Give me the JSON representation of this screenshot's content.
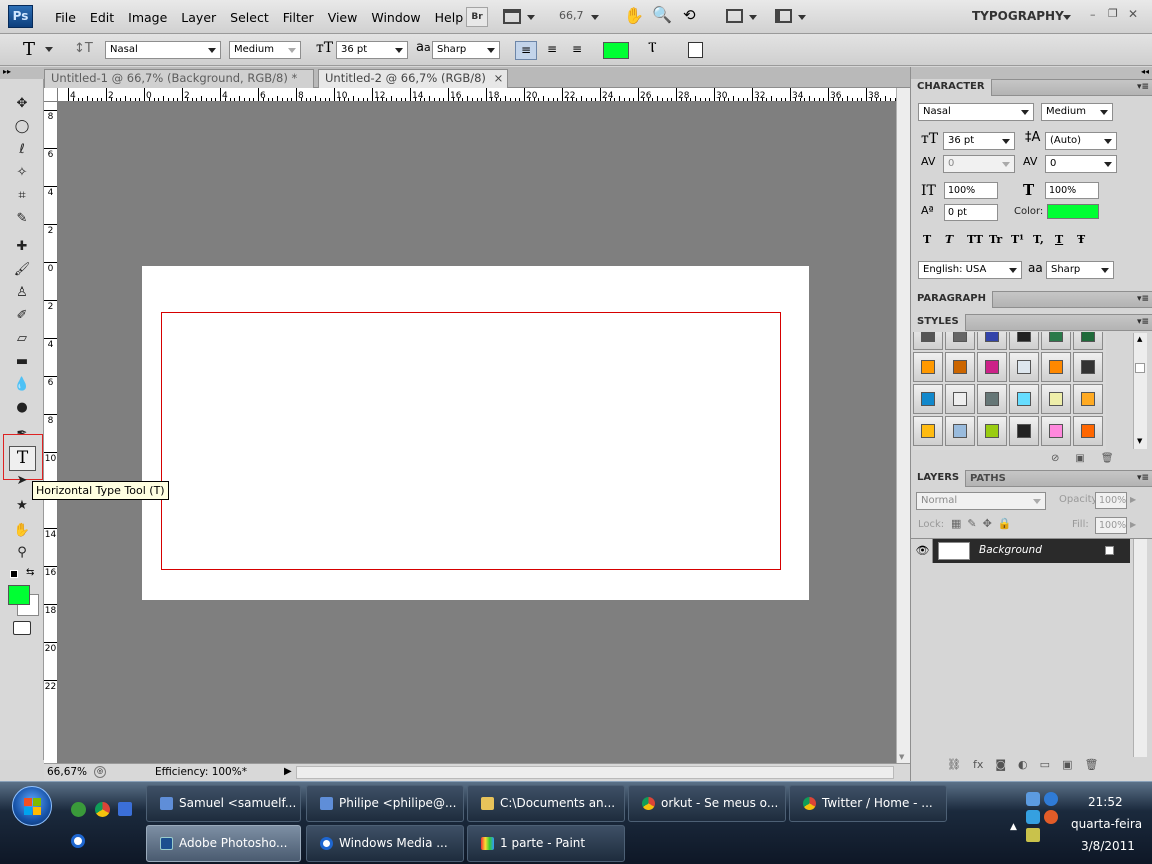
{
  "app": {
    "logo": "Ps",
    "workspace": "TYPOGRAPHY",
    "zoom_display": "66,7"
  },
  "menu": [
    "File",
    "Edit",
    "Image",
    "Layer",
    "Select",
    "Filter",
    "View",
    "Window",
    "Help"
  ],
  "toolbar_buttons": {
    "bridge": "Br"
  },
  "options": {
    "tool_glyph": "T",
    "font_family": "Nasal",
    "font_style": "Medium",
    "font_size": "36 pt",
    "aa_label": "a",
    "aa_method": "Sharp",
    "text_color": "#00ff33"
  },
  "tabs": [
    {
      "label": "Untitled-1 @ 66,7% (Background, RGB/8) *",
      "close": "×"
    },
    {
      "label": "Untitled-2 @ 66,7% (RGB/8)",
      "close": "×"
    }
  ],
  "ruler": {
    "h_ticks": [
      "4",
      "2",
      "0",
      "2",
      "4",
      "6",
      "8",
      "10",
      "12",
      "14",
      "16",
      "18",
      "20",
      "22",
      "24",
      "26",
      "28",
      "30",
      "32",
      "34",
      "36",
      "38"
    ],
    "v_ticks": [
      "8",
      "6",
      "4",
      "2",
      "0",
      "2",
      "4",
      "6",
      "8",
      "10",
      "12",
      "14",
      "16",
      "18",
      "20",
      "22"
    ]
  },
  "tooltip": "Horizontal Type Tool (T)",
  "status": {
    "zoom": "66,67%",
    "efficiency": "Efficiency: 100%*"
  },
  "character": {
    "title": "CHARACTER",
    "font_family": "Nasal",
    "font_style": "Medium",
    "size": "36 pt",
    "leading": "(Auto)",
    "kerning": "0",
    "tracking": "0",
    "vscale": "100%",
    "hscale": "100%",
    "baseline": "0 pt",
    "color_label": "Color:",
    "color": "#00ff33",
    "language": "English: USA",
    "aa": "Sharp",
    "style_buttons": [
      "T",
      "T",
      "TT",
      "Tr",
      "T¹",
      "T,",
      "T",
      "Ŧ"
    ]
  },
  "paragraph": {
    "title": "PARAGRAPH"
  },
  "styles": {
    "title": "STYLES",
    "swatches": [
      [
        "#555555",
        "#666666",
        "#3344aa",
        "#222222",
        "#2a7a4a",
        "#1f6a3a"
      ],
      [
        "#ff9900",
        "#cc6600",
        "#cc2288",
        "#dde6ee",
        "#ff8800",
        "#333333"
      ],
      [
        "#1188cc",
        "#eeeeee",
        "#667777",
        "#66ddff",
        "#eeeeaa",
        "#ffaa22"
      ],
      [
        "#ffbb11",
        "#99bbdd",
        "#99cc11",
        "#222222",
        "#ff88dd",
        "#ff6600"
      ]
    ]
  },
  "layers": {
    "tab_layers": "LAYERS",
    "tab_paths": "PATHS",
    "blend_mode": "Normal",
    "opacity_label": "Opacity:",
    "opacity": "100%",
    "lock_label": "Lock:",
    "fill_label": "Fill:",
    "fill": "100%",
    "layer_name": "Background"
  },
  "taskbar": {
    "row1": [
      "Samuel <samuelf...",
      "Philipe <philipe@...",
      "C:\\Documents an...",
      "orkut - Se meus o...",
      "Twitter / Home - ..."
    ],
    "row2": [
      "Adobe Photosho...",
      "Windows Media ...",
      "1 parte - Paint"
    ],
    "time": "21:52",
    "day": "quarta-feira",
    "date": "3/8/2011"
  }
}
